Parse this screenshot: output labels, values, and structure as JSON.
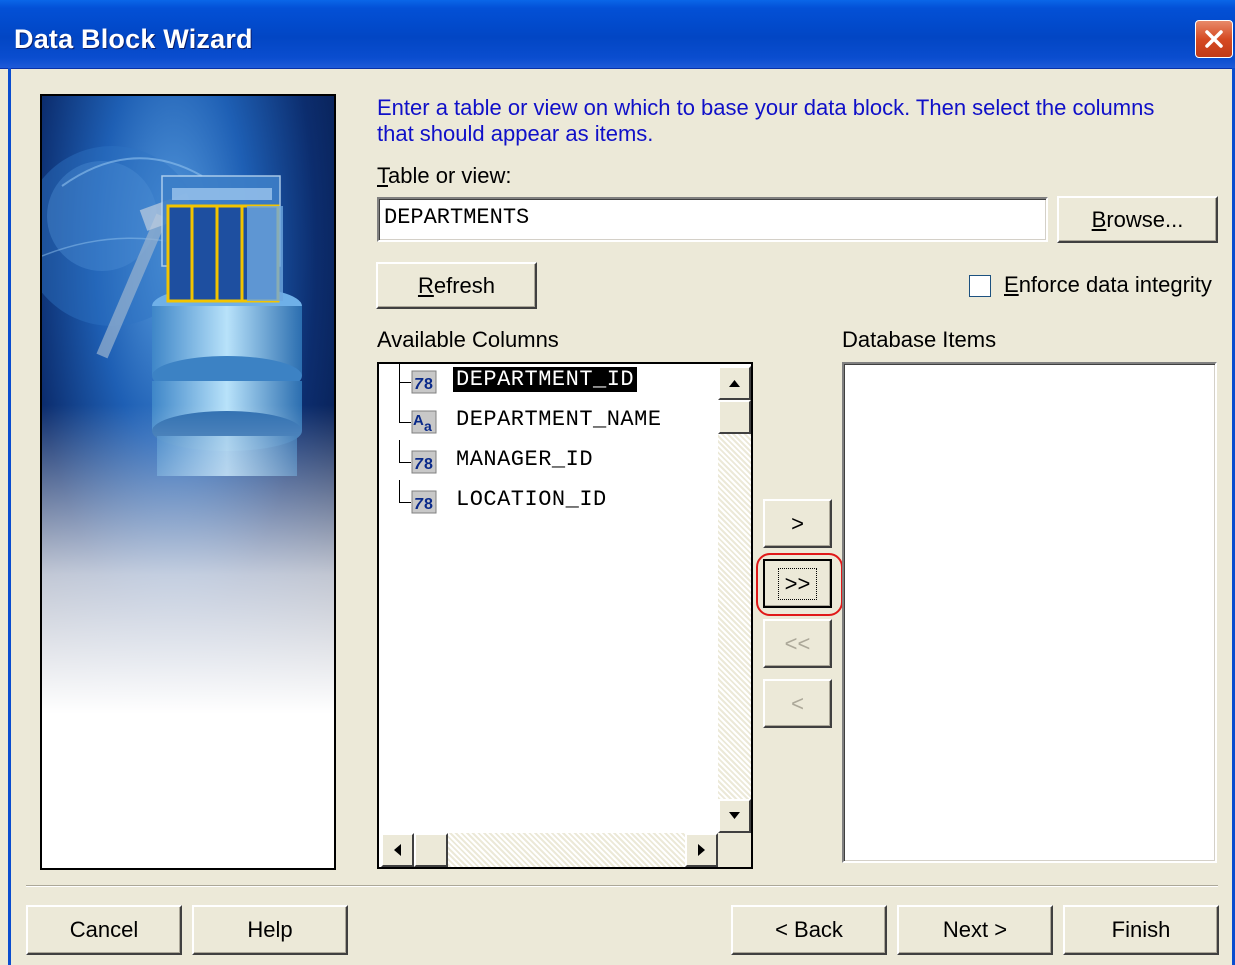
{
  "window": {
    "title": "Data Block Wizard",
    "close_icon": "close-icon"
  },
  "colors": {
    "titlebar": "#0246C4",
    "instruction_text": "#1010C8",
    "dialog_bg": "#ECE9D8",
    "selection_bg": "#000000",
    "highlight_ring": "#E01818"
  },
  "instruction": "Enter a table or view on which to base your data block. Then select the columns that should appear as items.",
  "table_or_view": {
    "label_mnemonic": "T",
    "label_rest": "able or view:",
    "value": "DEPARTMENTS",
    "browse_mnemonic": "B",
    "browse_rest": "rowse..."
  },
  "refresh": {
    "mnemonic": "R",
    "rest": "efresh"
  },
  "enforce_integrity": {
    "mnemonic": "E",
    "rest": "nforce data integrity",
    "checked": false
  },
  "available_columns": {
    "label": "Available Columns",
    "items": [
      {
        "name": "DEPARTMENT_ID",
        "icon": "number-type-icon",
        "selected": true
      },
      {
        "name": "DEPARTMENT_NAME",
        "icon": "text-type-icon",
        "selected": false
      },
      {
        "name": "MANAGER_ID",
        "icon": "number-type-icon",
        "selected": false
      },
      {
        "name": "LOCATION_ID",
        "icon": "number-type-icon",
        "selected": false
      }
    ]
  },
  "database_items": {
    "label": "Database Items",
    "items": []
  },
  "transfer_buttons": {
    "add_one": ">",
    "add_all": ">>",
    "remove_all": "<<",
    "remove_one": "<"
  },
  "footer": {
    "cancel": "Cancel",
    "help": "Help",
    "back": "< Back",
    "next": "Next >",
    "finish": "Finish"
  }
}
